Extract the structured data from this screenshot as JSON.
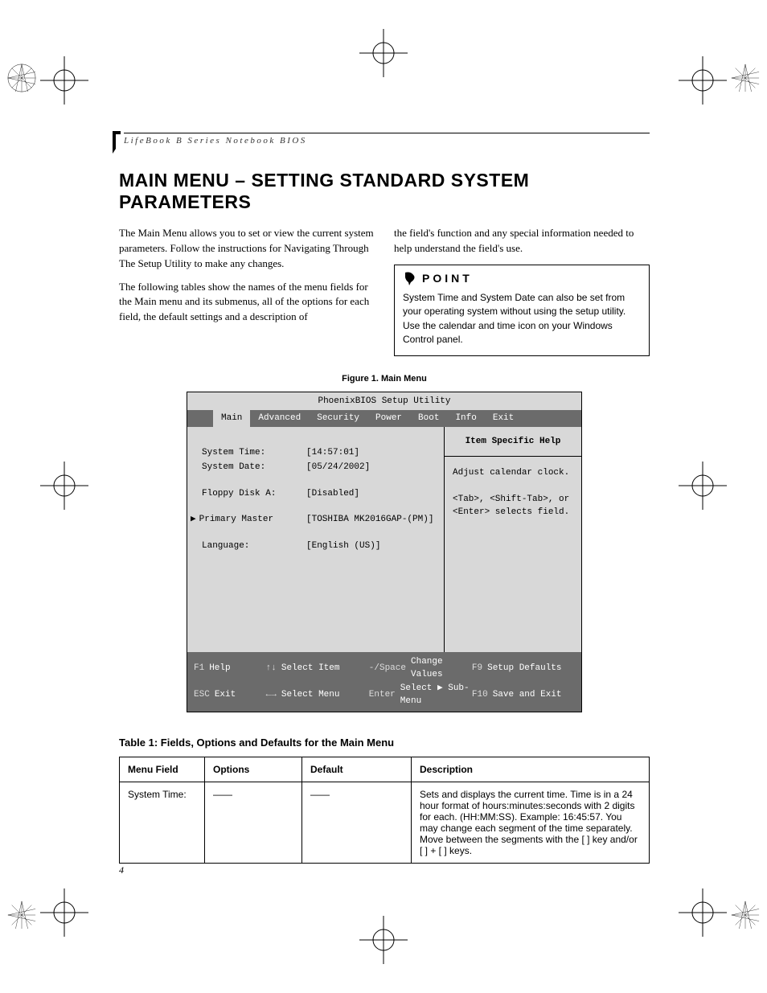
{
  "running_head": "LifeBook B Series Notebook BIOS",
  "title": "MAIN MENU – SETTING STANDARD SYSTEM PARAMETERS",
  "page_number": "4",
  "para1a": "The Main Menu allows you to set or view the current system parameters. Follow the instructions for ",
  "para1_link": "Navigating Through The Setup Utility",
  "para1b": " to make any changes.",
  "para2": "The following tables show the names of the menu fields for the Main menu and its submenus, all of the options for each field, the default settings and a description of",
  "para3": "the field's function and any special information needed to help understand the field's use.",
  "point_label": "POINT",
  "point_body": "System Time and System Date can also be set from your operating system without using the setup utility. Use the calendar and time icon on your Windows Control panel.",
  "figure_caption": "Figure 1.  Main Menu",
  "bios": {
    "title": "PhoenixBIOS Setup Utility",
    "tabs": [
      "Main",
      "Advanced",
      "Security",
      "Power",
      "Boot",
      "Info",
      "Exit"
    ],
    "rows": {
      "system_time_label": "System Time:",
      "system_time_value": "[14:57:01]",
      "system_date_label": "System Date:",
      "system_date_value": "[05/24/2002]",
      "floppy_label": "Floppy Disk A:",
      "floppy_value": "[Disabled]",
      "primary_label": "Primary Master",
      "primary_value": "[TOSHIBA MK2016GAP-(PM)]",
      "language_label": "Language:",
      "language_value": "[English (US)]"
    },
    "help_title": "Item Specific Help",
    "help_body1": "Adjust calendar clock.",
    "help_body2": "<Tab>, <Shift-Tab>, or <Enter> selects field.",
    "footer": {
      "f1": "F1",
      "help": "Help",
      "arrows_v": "↑↓",
      "select_item": "Select Item",
      "minus_space": "-/Space",
      "change_values": "Change Values",
      "f9": "F9",
      "setup_defaults": "Setup Defaults",
      "esc": "ESC",
      "exit": "Exit",
      "arrows_h": "←→",
      "select_menu": "Select Menu",
      "enter": "Enter",
      "select_sub": "Select ▶ Sub-Menu",
      "f10": "F10",
      "save_exit": "Save and Exit"
    }
  },
  "table_caption": "Table 1: Fields, Options and Defaults for the Main Menu",
  "table": {
    "headers": [
      "Menu Field",
      "Options",
      "Default",
      "Description"
    ],
    "row1": {
      "field": "System Time:",
      "options": "——",
      "default": "——",
      "desc": "Sets and displays the current time. Time is in a 24 hour format of hours:minutes:seconds with 2 digits for each. (HH:MM:SS). Example: 16:45:57. You may change each segment of the time separately. Move between the segments with the [    ] key and/or [    ] + [    ] keys."
    }
  }
}
